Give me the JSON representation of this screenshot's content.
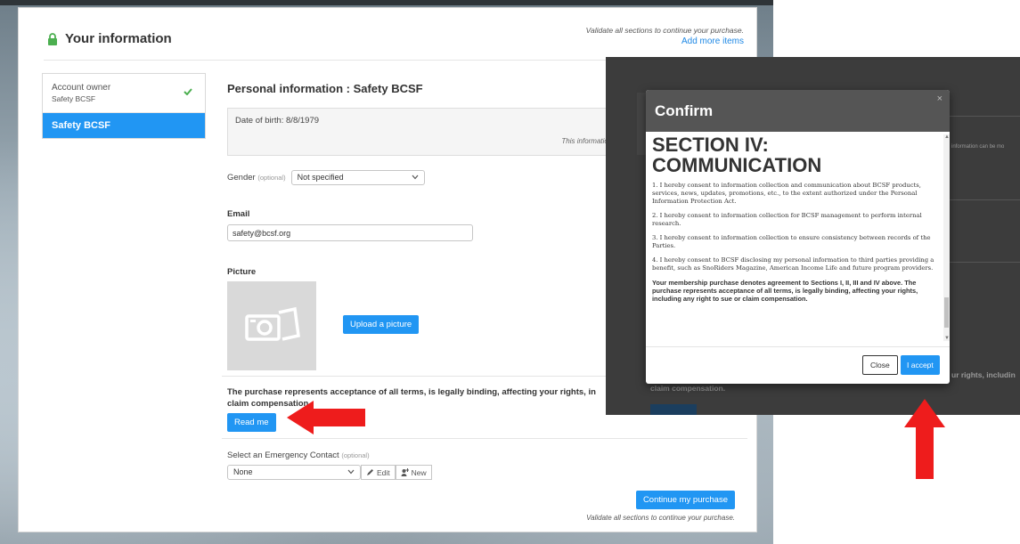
{
  "header": {
    "title": "Your information",
    "hint": "Validate all sections to continue your purchase.",
    "add_more_items": "Add more items"
  },
  "sidebar": {
    "items": [
      {
        "title": "Account owner",
        "subtitle": "Safety BCSF"
      },
      {
        "title": "Safety BCSF"
      }
    ]
  },
  "personal": {
    "title": "Personal information : Safety BCSF",
    "dob": "Date of birth: 8/8/1979",
    "info_note": "This information ca"
  },
  "gender": {
    "label": "Gender",
    "optional": "(optional)",
    "value": "Not specified"
  },
  "email": {
    "label": "Email",
    "value": "safety@bcsf.org"
  },
  "picture": {
    "label": "Picture",
    "upload": "Upload a picture"
  },
  "purchase": {
    "line1": "The purchase represents acceptance of all terms, is legally binding, affecting your rights, in",
    "line2": "claim compensation.",
    "read_me": "Read me"
  },
  "emergency": {
    "label": "Select an Emergency Contact",
    "optional": "(optional)",
    "value": "None",
    "edit": "Edit",
    "new": "New"
  },
  "footer": {
    "continue": "Continue my purchase",
    "hint": "Validate all sections to continue your purchase."
  },
  "background_fragments": {
    "right_note": "information can be mo",
    "rights_text": "ur rights, includin",
    "claim_text": "claim compensation.",
    "read_me": "Read me"
  },
  "modal": {
    "title": "Confirm",
    "close_x": "×",
    "section_title": "SECTION IV: COMMUNICATION",
    "paragraphs": [
      "1. I hereby consent to information collection and communication about BCSF products, services, news, updates, promotions, etc., to the extent authorized under the Personal Information Protection Act.",
      "2. I hereby consent to information collection for BCSF management to perform internal research.",
      "3. I hereby consent to information collection to ensure consistency between records of the Parties.",
      "4. I hereby consent to BCSF disclosing my personal information to third parties providing a benefit, such as SnoRiders Magazine, American Income Life and future program providers."
    ],
    "bold_paragraph": "Your membership purchase denotes agreement to Sections I, II, III and IV above. The purchase represents acceptance of all terms, is legally binding, affecting your rights, including any right to sue or claim compensation.",
    "close": "Close",
    "accept": "I accept"
  },
  "colors": {
    "accent": "#2196f3",
    "check": "#4caf50",
    "arrow": "#ee1c1c",
    "modal_header": "#555555"
  }
}
